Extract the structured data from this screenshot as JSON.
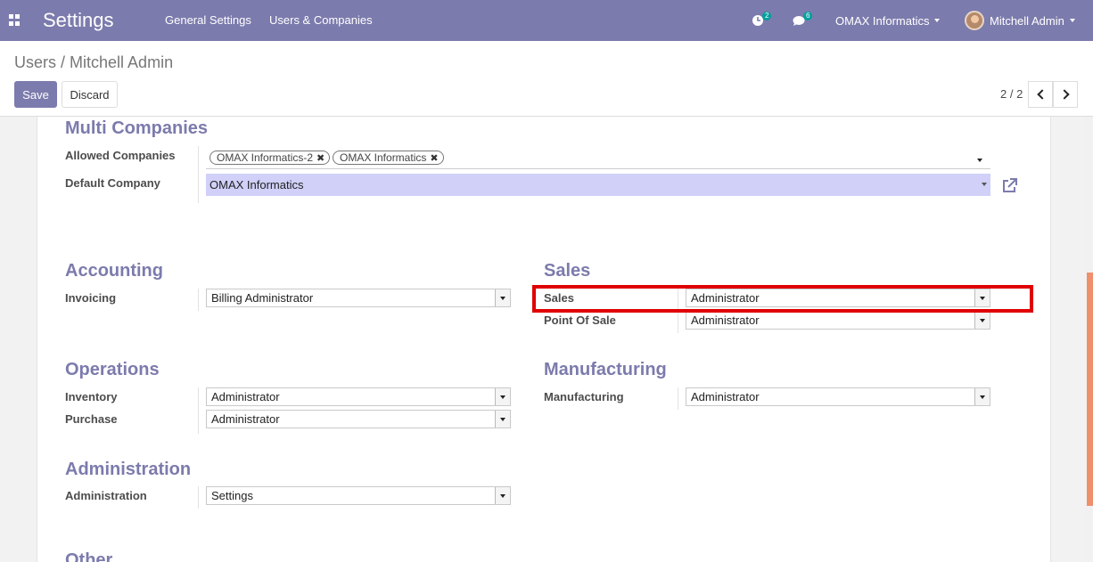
{
  "navbar": {
    "app_title": "Settings",
    "menu": [
      "General Settings",
      "Users & Companies"
    ],
    "activity_count": "2",
    "message_count": "6",
    "company_switcher": "OMAX Informatics",
    "user_name": "Mitchell Admin",
    "bg_color": "#7c7bad"
  },
  "breadcrumb": {
    "parent": "Users",
    "separator": "/",
    "current": "Mitchell Admin"
  },
  "buttons": {
    "save": "Save",
    "discard": "Discard"
  },
  "pager": {
    "value": "2 / 2"
  },
  "multi_companies": {
    "title": "Multi Companies",
    "allowed_label": "Allowed Companies",
    "allowed_tags": [
      "OMAX Informatics-2",
      "OMAX Informatics"
    ],
    "default_label": "Default Company",
    "default_value": "OMAX Informatics"
  },
  "accounting": {
    "title": "Accounting",
    "invoicing_label": "Invoicing",
    "invoicing_value": "Billing Administrator"
  },
  "sales": {
    "title": "Sales",
    "sales_label": "Sales",
    "sales_value": "Administrator",
    "pos_label": "Point Of Sale",
    "pos_value": "Administrator"
  },
  "operations": {
    "title": "Operations",
    "inventory_label": "Inventory",
    "inventory_value": "Administrator",
    "purchase_label": "Purchase",
    "purchase_value": "Administrator"
  },
  "manufacturing": {
    "title": "Manufacturing",
    "mrp_label": "Manufacturing",
    "mrp_value": "Administrator"
  },
  "administration": {
    "title": "Administration",
    "admin_label": "Administration",
    "admin_value": "Settings"
  },
  "other": {
    "title": "Other"
  },
  "highlight_color": "#e00000"
}
